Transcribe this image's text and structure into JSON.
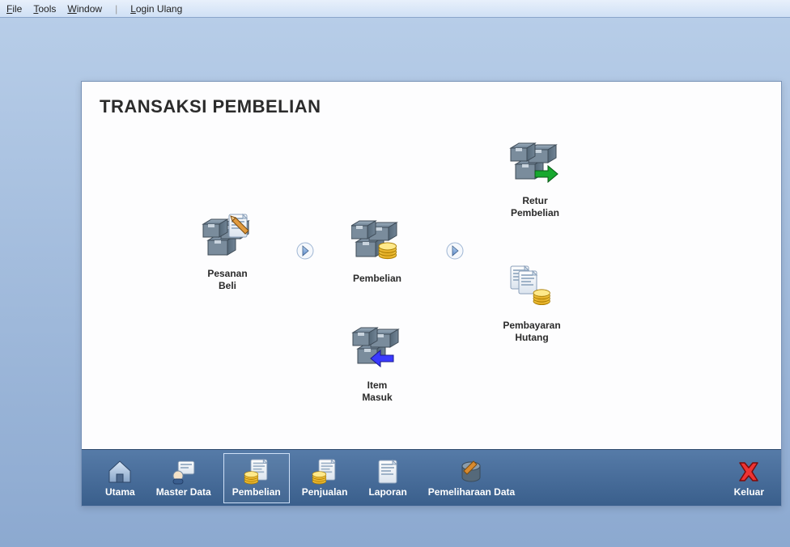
{
  "menu": {
    "file": "File",
    "tools": "Tools",
    "window": "Window",
    "login": "Login Ulang"
  },
  "window_title": "TRANSAKSI PEMBELIAN",
  "flow": {
    "pesanan_beli": "Pesanan\nBeli",
    "pembelian": "Pembelian",
    "item_masuk": "Item\nMasuk",
    "retur_pembelian": "Retur\nPembelian",
    "pembayaran_hutang": "Pembayaran\nHutang"
  },
  "bottom": {
    "utama": "Utama",
    "master_data": "Master Data",
    "pembelian": "Pembelian",
    "penjualan": "Penjualan",
    "laporan": "Laporan",
    "pemeliharaan": "Pemeliharaan Data",
    "keluar": "Keluar"
  }
}
